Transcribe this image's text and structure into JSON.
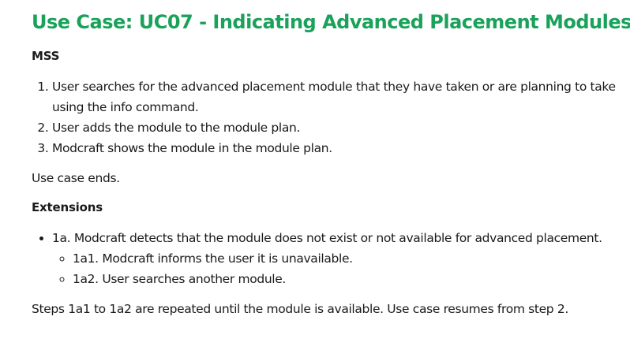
{
  "title": "Use Case: UC07 - Indicating Advanced Placement Modules",
  "title_color": "#1aa15a",
  "mss": {
    "heading": "MSS",
    "steps": [
      "User searches for the advanced placement module that they have taken or are planning to take using the info command.",
      "User adds the module to the module plan.",
      "Modcraft shows the module in the module plan."
    ],
    "end_text": "Use case ends."
  },
  "extensions": {
    "heading": "Extensions",
    "items": [
      {
        "text": "1a. Modcraft detects that the module does not exist or not available for advanced placement.",
        "sub_items": [
          "1a1. Modcraft informs the user it is unavailable.",
          "1a2. User searches another module."
        ]
      }
    ],
    "note": "Steps 1a1 to 1a2 are repeated until the module is available. Use case resumes from step 2."
  }
}
